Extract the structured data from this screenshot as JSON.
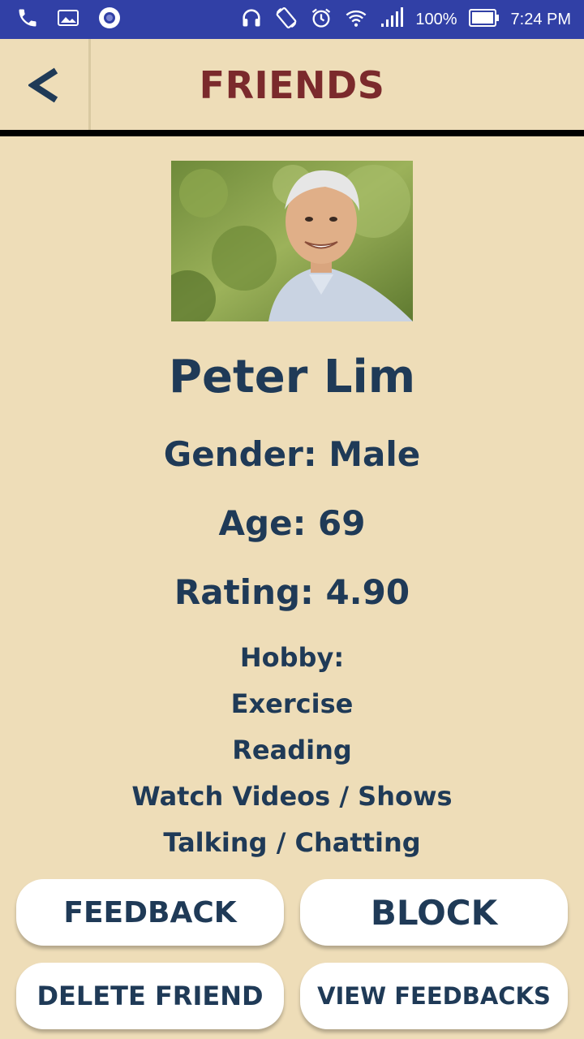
{
  "status_bar": {
    "icons_left": [
      "phone-icon",
      "image-icon",
      "record-icon"
    ],
    "icons_right": [
      "headphones-icon",
      "rotate-icon",
      "alarm-icon",
      "wifi-icon",
      "signal-icon",
      "battery-icon"
    ],
    "battery": "100%",
    "time": "7:24 PM",
    "background": "#3140A6"
  },
  "header": {
    "back_label": "<",
    "title": "FRIENDS"
  },
  "profile": {
    "photo_description_icon": "profile-photo",
    "name": "Peter Lim",
    "gender": "Gender: Male",
    "age": "Age: 69",
    "rating": "Rating: 4.90",
    "hobby_heading": "Hobby:",
    "hobbies": [
      "Exercise",
      "Reading",
      "Watch Videos / Shows",
      "Talking / Chatting"
    ]
  },
  "actions": {
    "feedback": "FEEDBACK",
    "block": "BLOCK",
    "delete_friend": "DELETE FRIEND",
    "view_feedbacks": "VIEW FEEDBACKS"
  },
  "colors": {
    "background": "#EEDDB8",
    "title": "#7B2A2C",
    "text": "#1F3A57",
    "button": "#FFFFFF"
  }
}
